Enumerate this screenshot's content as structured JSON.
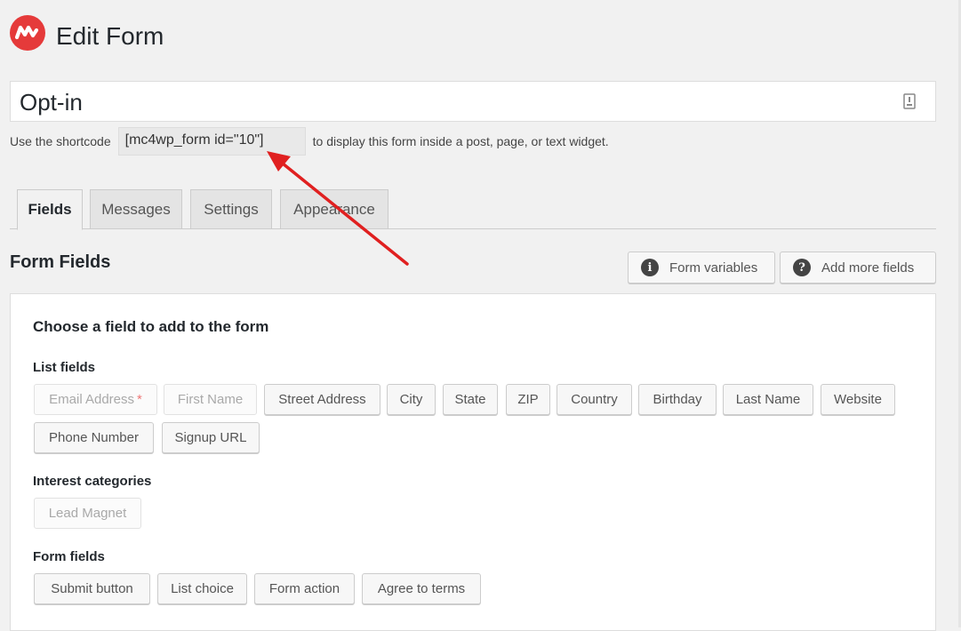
{
  "header": {
    "title": "Edit Form"
  },
  "form": {
    "name": "Opt-in"
  },
  "shortcode": {
    "prefix": "Use the shortcode",
    "code": "[mc4wp_form id=\"10\"]",
    "suffix": "to display this form inside a post, page, or text widget."
  },
  "tabs": [
    {
      "label": "Fields",
      "active": true
    },
    {
      "label": "Messages",
      "active": false
    },
    {
      "label": "Settings",
      "active": false
    },
    {
      "label": "Appearance",
      "active": false
    }
  ],
  "section": {
    "title": "Form Fields",
    "form_variables_label": "Form variables",
    "add_more_fields_label": "Add more fields"
  },
  "panel": {
    "heading": "Choose a field to add to the form",
    "list_fields_label": "List fields",
    "list_fields": [
      {
        "label": "Email Address",
        "required_mark": "*",
        "disabled": true
      },
      {
        "label": "First Name",
        "disabled": true
      },
      {
        "label": "Street Address"
      },
      {
        "label": "City"
      },
      {
        "label": "State"
      },
      {
        "label": "ZIP"
      },
      {
        "label": "Country"
      },
      {
        "label": "Birthday"
      },
      {
        "label": "Last Name"
      },
      {
        "label": "Website"
      },
      {
        "label": "Phone Number"
      },
      {
        "label": "Signup URL"
      }
    ],
    "interest_label": "Interest categories",
    "interest_fields": [
      {
        "label": "Lead Magnet",
        "disabled": true
      }
    ],
    "form_fields_label": "Form fields",
    "form_fields": [
      {
        "label": "Submit button"
      },
      {
        "label": "List choice"
      },
      {
        "label": "Form action"
      },
      {
        "label": "Agree to terms"
      }
    ]
  },
  "colors": {
    "logo": "#e53a3a",
    "arrow": "#e02020"
  }
}
